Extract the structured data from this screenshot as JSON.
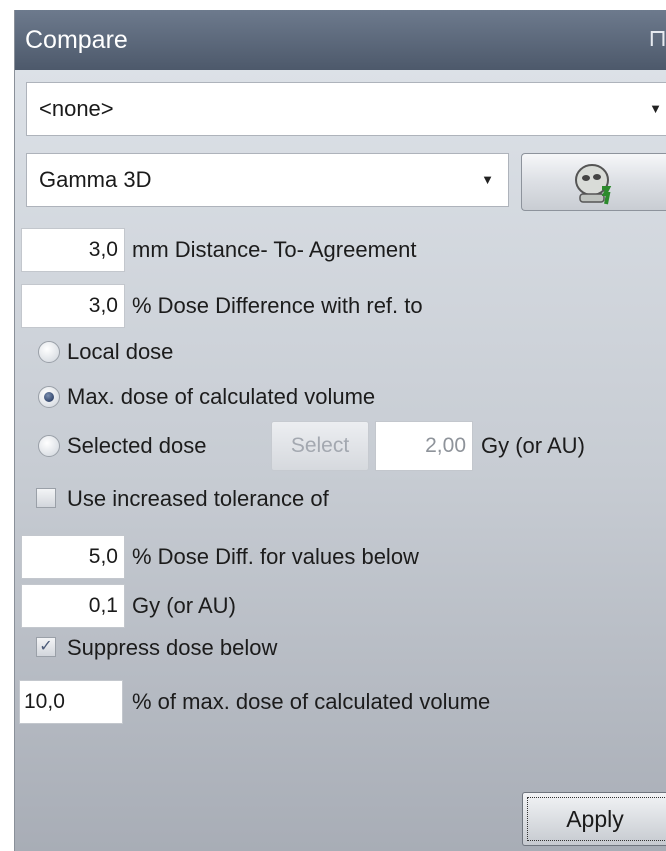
{
  "panel": {
    "title": "Compare",
    "pin_icon": "pin-icon"
  },
  "reference_select": {
    "value": "<none>"
  },
  "method_select": {
    "value": "Gamma 3D",
    "tool_icon": "gamma-tool-icon"
  },
  "dta": {
    "value": "3,0",
    "label": "mm Distance- To- Agreement"
  },
  "dose_diff": {
    "value": "3,0",
    "label": "% Dose Difference with ref. to"
  },
  "ref_options": {
    "local": "Local dose",
    "max": "Max. dose of calculated volume",
    "selected": "Selected dose",
    "selected_state": "max"
  },
  "select_button": {
    "label": "Select"
  },
  "selected_dose": {
    "value": "2,00",
    "unit": "Gy (or AU)"
  },
  "increased_tolerance": {
    "checked": false,
    "label": "Use increased tolerance of"
  },
  "tol_percent": {
    "value": "5,0",
    "label": "% Dose Diff. for values below"
  },
  "tol_gy": {
    "value": "0,1",
    "label": "Gy (or AU)"
  },
  "suppress": {
    "checked": true,
    "label": "Suppress dose below"
  },
  "suppress_value": {
    "value": "10,0",
    "label": "% of max. dose of calculated volume"
  },
  "apply_button": {
    "label": "Apply"
  }
}
